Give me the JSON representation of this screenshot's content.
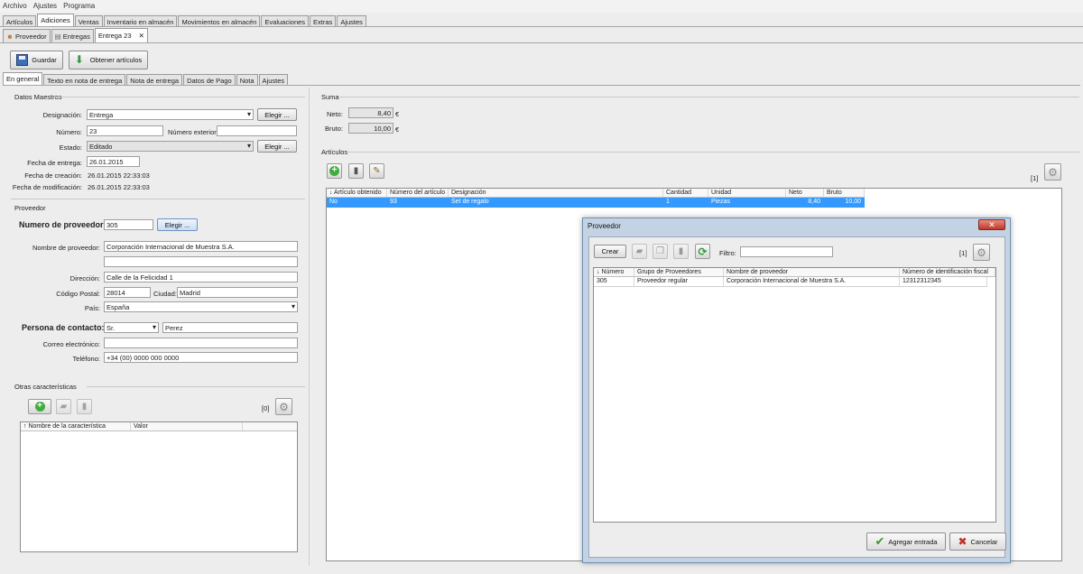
{
  "menu": [
    "Archivo",
    "Ajustes",
    "Programa"
  ],
  "main_tabs": [
    "Artículos",
    "Adiciones",
    "Ventas",
    "Inventario en almacén",
    "Movimientos en almacén",
    "Evaluaciones",
    "Extras",
    "Ajustes"
  ],
  "sub_tabs": [
    "Proveedor",
    "Entregas",
    "Entrega 23"
  ],
  "toolbar": {
    "save_label": "Guardar",
    "get_articles_label": "Obtener artículos"
  },
  "detail_tabs": [
    "En general",
    "Texto en nota de entrega",
    "Nota de entrega",
    "Datos de Pago",
    "Nota",
    "Ajustes"
  ],
  "master": {
    "title": "Datos Maestros",
    "designation_label": "Designación:",
    "designation_value": "Entrega",
    "choose_label": "Elegir ...",
    "number_label": "Número:",
    "number_value": "23",
    "external_label": "Número exterior:",
    "external_value": "",
    "state_label": "Estado:",
    "state_value": "Editado",
    "choose2_label": "Elegir ...",
    "delivery_date_label": "Fecha de entrega:",
    "delivery_date_value": "26.01.2015",
    "created_label": "Fecha de creación:",
    "created_value": "26.01.2015  22:33:03",
    "modified_label": "Fecha de modificación:",
    "modified_value": "26.01.2015  22:33:03"
  },
  "supplier": {
    "title": "Proveedor",
    "number_label": "Numero de proveedor:",
    "number_value": "305",
    "choose_label": "Elegir ...",
    "name_label": "Nombre de proveedor:",
    "name_value": "Corporación Internacional de Muestra S.A.",
    "name2_value": "",
    "address_label": "Dirección:",
    "address_value": "Calle de la Felicidad 1",
    "postal_label": "Código Postal:",
    "postal_value": "28014",
    "city_label": "Ciudad:",
    "city_value": "Madrid",
    "country_label": "País:",
    "country_value": "España",
    "contact_label": "Persona de contacto:",
    "salutation_value": "Sr.",
    "contact_value": "Perez",
    "email_label": "Correo electrónico:",
    "email_value": "",
    "phone_label": "Teléfono:",
    "phone_value": "+34 (00) 0000 000 0000"
  },
  "other": {
    "title": "Otras características",
    "count": "[0]",
    "col_name": "↑ Nombre de la característica",
    "col_value": "Valor"
  },
  "sum": {
    "title": "Suma",
    "net_label": "Neto:",
    "net_value": "8,40",
    "gross_label": "Bruto:",
    "gross_value": "10,00",
    "currency": "€"
  },
  "articles": {
    "title": "Artículos",
    "count": "[1]",
    "columns": [
      "↓ Artículo obtenido",
      "Número del artículo",
      "Designación",
      "Cantidad",
      "Unidad",
      "Neto",
      "Bruto"
    ],
    "rows": [
      [
        "No",
        "93",
        "Set de regalo",
        "1",
        "Piezas",
        "8,40",
        "10,00"
      ]
    ]
  },
  "dialog": {
    "title": "Proveedor",
    "close": "✕",
    "create_label": "Crear",
    "filter_label": "Filtro:",
    "filter_value": "",
    "count": "[1]",
    "columns": [
      "↓ Número",
      "Grupo de Proveedores",
      "Nombre de proveedor",
      "Número de identificación fiscal"
    ],
    "rows": [
      [
        "305",
        "Proveedor regular",
        "Corporación Internacional de Muestra S.A.",
        "12312312345"
      ]
    ],
    "add_label": "Agregar entrada",
    "cancel_label": "Cancelar"
  },
  "colors": {
    "selection": "#3399ff",
    "dialog_frame": "#c4d3e3"
  }
}
